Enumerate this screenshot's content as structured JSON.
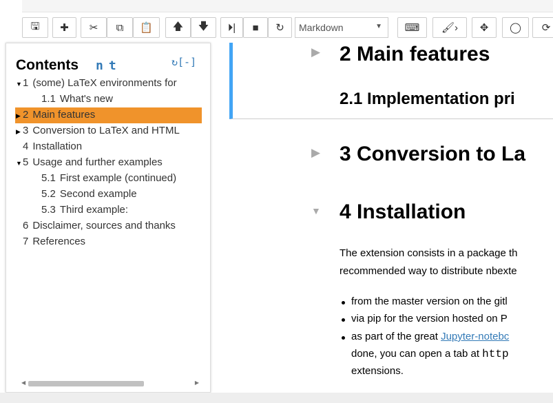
{
  "toolbar": {
    "buttons": [
      {
        "name": "save-button",
        "icon": "floppy-icon",
        "glyph": "🖫"
      },
      {
        "name": "insert-cell-button",
        "icon": "plus-icon",
        "glyph": "✚"
      },
      {
        "name": "cut-button",
        "icon": "scissors-icon",
        "glyph": "✂"
      },
      {
        "name": "copy-button",
        "icon": "copy-icon",
        "glyph": "⧉"
      },
      {
        "name": "paste-button",
        "icon": "paste-icon",
        "glyph": "📋"
      },
      {
        "name": "move-up-button",
        "icon": "arrow-up-icon",
        "glyph": "🡅"
      },
      {
        "name": "move-down-button",
        "icon": "arrow-down-icon",
        "glyph": "🡇"
      },
      {
        "name": "run-button",
        "icon": "step-forward-icon",
        "glyph": "⏵|"
      },
      {
        "name": "stop-button",
        "icon": "stop-icon",
        "glyph": "■"
      },
      {
        "name": "restart-button",
        "icon": "redo-icon",
        "glyph": "↻"
      },
      {
        "name": "keyboard-button",
        "icon": "keyboard-icon",
        "glyph": "⌨"
      },
      {
        "name": "paint-button",
        "icon": "paintbrush-icon",
        "glyph": "🖌›"
      },
      {
        "name": "move-button",
        "icon": "move-icon",
        "glyph": "✥"
      },
      {
        "name": "github-button",
        "icon": "github-icon",
        "glyph": "◯"
      },
      {
        "name": "refresh-button",
        "icon": "refresh-icon",
        "glyph": "⟳"
      }
    ],
    "cell_type": "Markdown"
  },
  "toc": {
    "title": "Contents",
    "n": "n",
    "t": "t",
    "controls": "↻[-]",
    "items": [
      {
        "num": "1",
        "label": "(some) LaTeX environments for",
        "toggle": "▼"
      },
      {
        "num": "1.1",
        "label": "What's new",
        "toggle": ""
      },
      {
        "num": "2",
        "label": "Main features",
        "toggle": "▶"
      },
      {
        "num": "3",
        "label": "Conversion to LaTeX and HTML",
        "toggle": "▶"
      },
      {
        "num": "4",
        "label": "Installation",
        "toggle": ""
      },
      {
        "num": "5",
        "label": "Usage and further examples",
        "toggle": "▼"
      },
      {
        "num": "5.1",
        "label": "First example (continued)",
        "toggle": ""
      },
      {
        "num": "5.2",
        "label": "Second example",
        "toggle": ""
      },
      {
        "num": "5.3",
        "label": "Third example:",
        "toggle": ""
      },
      {
        "num": "6",
        "label": "Disclaimer, sources and thanks",
        "toggle": ""
      },
      {
        "num": "7",
        "label": "References",
        "toggle": ""
      }
    ],
    "highlight_color": "#f0932b"
  },
  "notebook": {
    "h2": "2  Main features",
    "h21": "2.1  Implementation pri",
    "h3": "3  Conversion to La",
    "h4": "4  Installation",
    "para": [
      "The extension consists in a package th",
      "recommended way to distribute nbexte"
    ],
    "bullets": [
      "from the master version on the gitl",
      "via pip for the version hosted on P"
    ],
    "bullet3_pre": "as part of the great ",
    "bullet3_link": "Jupyter-notebc",
    "bullet3_l2": "done, you can open a tab at ",
    "bullet3_code": "http",
    "bullet3_l3": "extensions.",
    "accent": "#42a5f5"
  }
}
